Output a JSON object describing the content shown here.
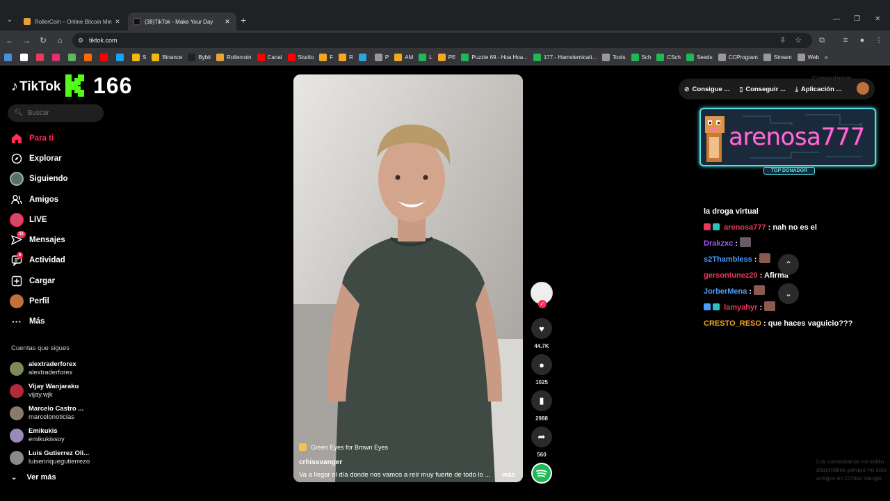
{
  "browser": {
    "tabs": [
      {
        "title": "RollerCoin – Online Bitcoin Min",
        "active": false
      },
      {
        "title": "(38)TikTok - Make Your Day",
        "active": true
      }
    ],
    "url": "tiktok.com",
    "bookmarks": [
      "",
      "",
      "",
      "",
      "",
      "",
      "",
      "",
      "S",
      "Binance",
      "Bybit",
      "Rollercoin",
      "Canal",
      "Studio",
      "F",
      "R",
      "",
      "P",
      "AM",
      "L",
      "PE",
      "Puzzle 69.- Hoa Hoa...",
      "177.- Hamsternicati...",
      "Tools",
      "Sch",
      "CSch",
      "Seeds",
      "CCProgram",
      "Stream",
      "Web"
    ]
  },
  "tiktok": {
    "brand": "TikTok",
    "overlay_number": "166",
    "search_placeholder": "Buscar",
    "nav": [
      {
        "label": "Para ti",
        "icon": "home-icon",
        "active": true
      },
      {
        "label": "Explorar",
        "icon": "compass-icon"
      },
      {
        "label": "Siguiendo",
        "icon": "following-icon"
      },
      {
        "label": "Amigos",
        "icon": "friends-icon"
      },
      {
        "label": "LIVE",
        "icon": "live-icon"
      },
      {
        "label": "Mensajes",
        "icon": "messages-icon",
        "badge": "33"
      },
      {
        "label": "Actividad",
        "icon": "activity-icon",
        "badge": "5"
      },
      {
        "label": "Cargar",
        "icon": "upload-icon"
      },
      {
        "label": "Perfil",
        "icon": "profile-icon"
      },
      {
        "label": "Más",
        "icon": "more-icon"
      }
    ],
    "following_title": "Cuentas que sigues",
    "following": [
      {
        "name": "alextraderforex",
        "user": "alextraderforex"
      },
      {
        "name": "Vijay Wanjaraku",
        "user": "vijay.wjk"
      },
      {
        "name": "Marcelo Castro ...",
        "user": "marcelonoticias"
      },
      {
        "name": "Emikukis",
        "user": "emikukissoy"
      },
      {
        "name": "Luis Gutierrez Oli...",
        "user": "luisenriquegutierrezo"
      }
    ],
    "ver_mas": "Ver más"
  },
  "video": {
    "sound": "Green Eyes for Brown Eyes",
    "author": "crhissvanger",
    "description": "Va a llegar el día donde nos vamos a reír muy fuerte de todo lo ...",
    "more": "más",
    "likes": "44.7K",
    "comments": "1025",
    "saves": "2988",
    "shares": "560"
  },
  "right_panel": {
    "header_buttons": [
      "Consigue ...",
      "Conseguir ...",
      "Aplicación ..."
    ],
    "comentarios_ghost": "Comentarios",
    "donor_name": "arenosa777",
    "donor_tag": "TOP DONADOR",
    "chat": [
      {
        "user": "",
        "text": "la droga virtual",
        "user_color": "#ffffff"
      },
      {
        "user": "arenosa777",
        "text": ": nah no es el",
        "user_color": "#e8395a"
      },
      {
        "user": "Drakzxc",
        "text": ":",
        "user_color": "#a855f7"
      },
      {
        "user": "s2Thambless",
        "text": ":",
        "user_color": "#4a9eff"
      },
      {
        "user": "gersontunez20",
        "text": ": Afirma",
        "user_color": "#e8395a"
      },
      {
        "user": "JorberMena",
        "text": ":",
        "user_color": "#4a9eff"
      },
      {
        "user": "lamyahyr",
        "text": ":",
        "user_color": "#e8395a"
      },
      {
        "user": "CRESTO_RESO",
        "text": ": que haces vaguicio???",
        "user_color": "#f5a623"
      }
    ],
    "faded_note": "Los comentarios no están disponibles porque no sois amigos en Crhiss Vanger"
  }
}
